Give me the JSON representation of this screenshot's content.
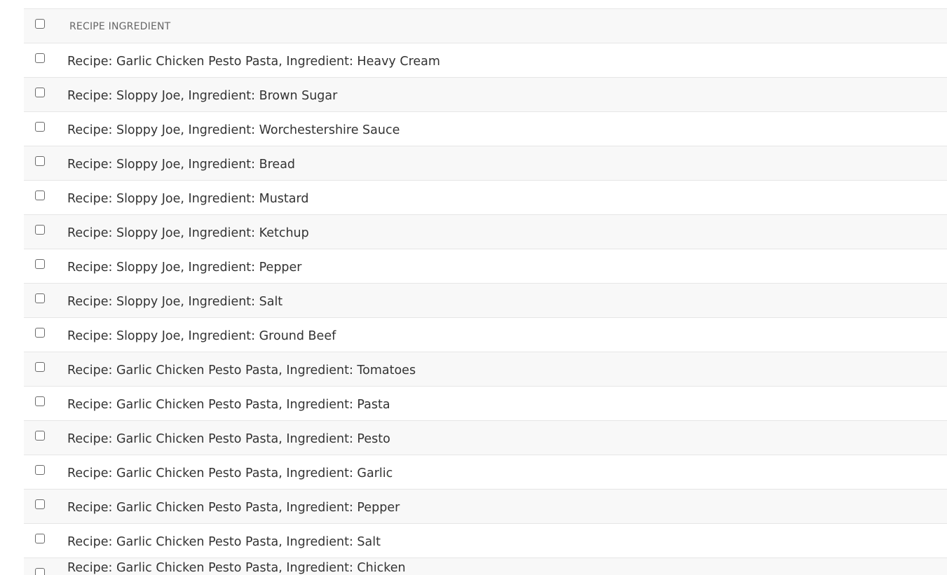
{
  "table": {
    "header": "RECIPE INGREDIENT",
    "rows": [
      "Recipe: Garlic Chicken Pesto Pasta, Ingredient: Heavy Cream",
      "Recipe: Sloppy Joe, Ingredient: Brown Sugar",
      "Recipe: Sloppy Joe, Ingredient: Worchestershire Sauce",
      "Recipe: Sloppy Joe, Ingredient: Bread",
      "Recipe: Sloppy Joe, Ingredient: Mustard",
      "Recipe: Sloppy Joe, Ingredient: Ketchup",
      "Recipe: Sloppy Joe, Ingredient: Pepper",
      "Recipe: Sloppy Joe, Ingredient: Salt",
      "Recipe: Sloppy Joe, Ingredient: Ground Beef",
      "Recipe: Garlic Chicken Pesto Pasta, Ingredient: Tomatoes",
      "Recipe: Garlic Chicken Pesto Pasta, Ingredient: Pasta",
      "Recipe: Garlic Chicken Pesto Pasta, Ingredient: Pesto",
      "Recipe: Garlic Chicken Pesto Pasta, Ingredient: Garlic",
      "Recipe: Garlic Chicken Pesto Pasta, Ingredient: Pepper",
      "Recipe: Garlic Chicken Pesto Pasta, Ingredient: Salt",
      "Recipe: Garlic Chicken Pesto Pasta, Ingredient: Chicken"
    ]
  }
}
